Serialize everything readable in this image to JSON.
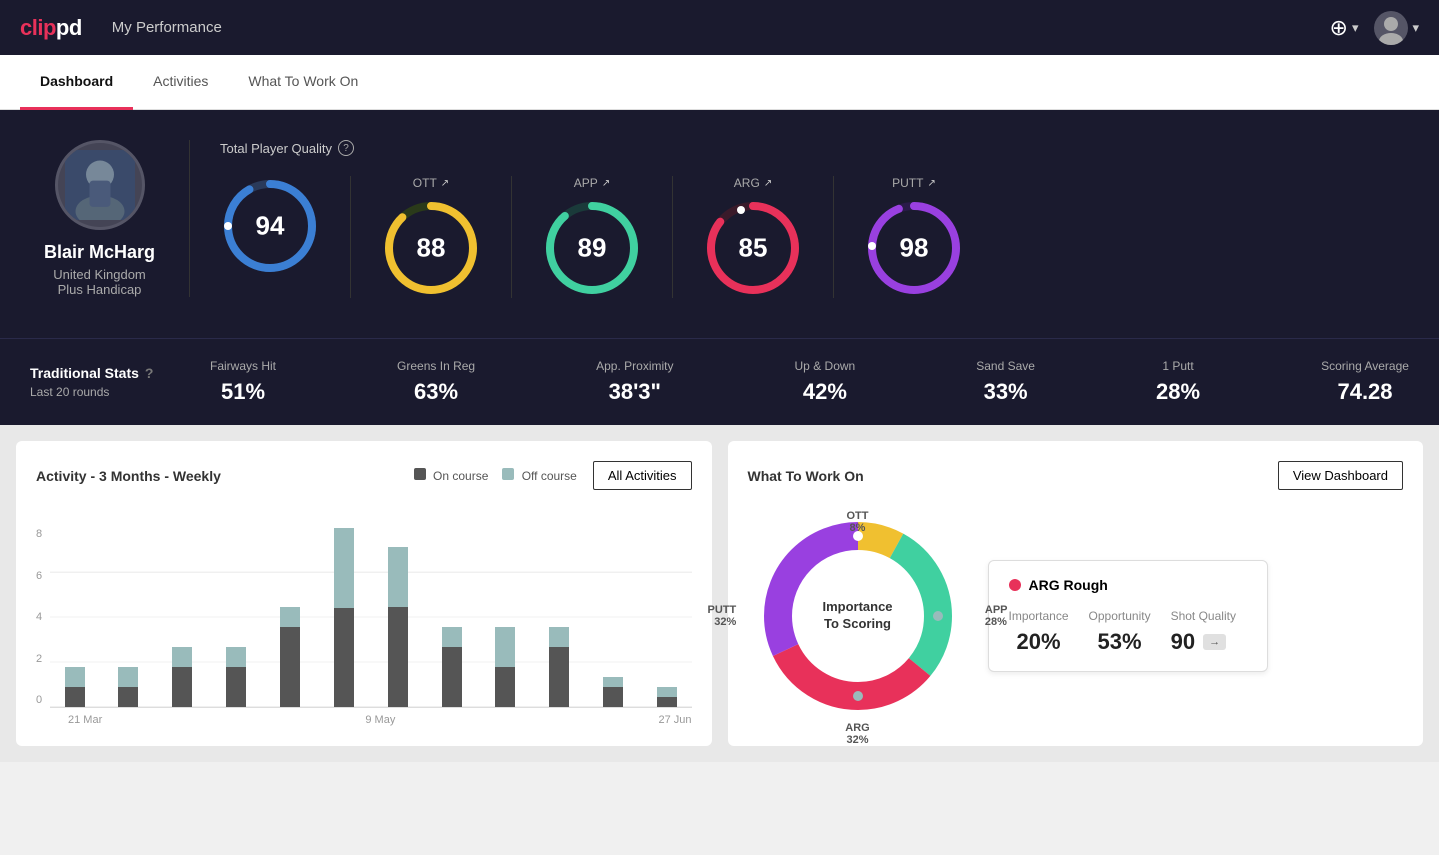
{
  "header": {
    "logo": "clippd",
    "title": "My Performance",
    "add_icon": "⊕",
    "chevron": "▾"
  },
  "tabs": [
    {
      "id": "dashboard",
      "label": "Dashboard",
      "active": true
    },
    {
      "id": "activities",
      "label": "Activities",
      "active": false
    },
    {
      "id": "what-to-work-on",
      "label": "What To Work On",
      "active": false
    }
  ],
  "player": {
    "name": "Blair McHarg",
    "country": "United Kingdom",
    "handicap": "Plus Handicap"
  },
  "total_player_quality": {
    "label": "Total Player Quality",
    "value": 94,
    "color": "#3b7fd4",
    "track_color": "#2a3a5a"
  },
  "scores": [
    {
      "id": "ott",
      "label": "OTT",
      "value": 88,
      "color": "#f0c030",
      "track": "#2a3a2a"
    },
    {
      "id": "app",
      "label": "APP",
      "value": 89,
      "color": "#40d0a0",
      "track": "#1a3a3a"
    },
    {
      "id": "arg",
      "label": "ARG",
      "value": 85,
      "color": "#e8315a",
      "track": "#3a1a2a"
    },
    {
      "id": "putt",
      "label": "PUTT",
      "value": 98,
      "color": "#9940e0",
      "track": "#2a1a4a"
    }
  ],
  "traditional_stats": {
    "title": "Traditional Stats",
    "subtitle": "Last 20 rounds",
    "items": [
      {
        "id": "fairways-hit",
        "label": "Fairways Hit",
        "value": "51%"
      },
      {
        "id": "greens-in-reg",
        "label": "Greens In Reg",
        "value": "63%"
      },
      {
        "id": "app-proximity",
        "label": "App. Proximity",
        "value": "38'3\""
      },
      {
        "id": "up-down",
        "label": "Up & Down",
        "value": "42%"
      },
      {
        "id": "sand-save",
        "label": "Sand Save",
        "value": "33%"
      },
      {
        "id": "1-putt",
        "label": "1 Putt",
        "value": "28%"
      },
      {
        "id": "scoring-average",
        "label": "Scoring Average",
        "value": "74.28"
      }
    ]
  },
  "activity_chart": {
    "title": "Activity - 3 Months - Weekly",
    "legend": [
      {
        "label": "On course",
        "color": "#555"
      },
      {
        "label": "Off course",
        "color": "#9bb"
      }
    ],
    "all_activities_btn": "All Activities",
    "y_labels": [
      "8",
      "6",
      "4",
      "2",
      "0"
    ],
    "x_labels": [
      "21 Mar",
      "9 May",
      "27 Jun"
    ],
    "bars": [
      {
        "on": 1,
        "off": 1
      },
      {
        "on": 1,
        "off": 1
      },
      {
        "on": 2,
        "off": 1
      },
      {
        "on": 2,
        "off": 1
      },
      {
        "on": 4,
        "off": 1
      },
      {
        "on": 5,
        "off": 4
      },
      {
        "on": 5,
        "off": 3
      },
      {
        "on": 3,
        "off": 1
      },
      {
        "on": 2,
        "off": 2
      },
      {
        "on": 3,
        "off": 1
      },
      {
        "on": 1,
        "off": 0.5
      },
      {
        "on": 0.5,
        "off": 0.5
      }
    ]
  },
  "what_to_work_on": {
    "title": "What To Work On",
    "view_dashboard_btn": "View Dashboard",
    "donut_center": "Importance\nTo Scoring",
    "segments": [
      {
        "id": "ott",
        "label": "OTT",
        "percent": "8%",
        "color": "#f0c030",
        "pct_num": 8
      },
      {
        "id": "app",
        "label": "APP",
        "percent": "28%",
        "color": "#40d0a0",
        "pct_num": 28
      },
      {
        "id": "arg",
        "label": "ARG",
        "percent": "32%",
        "color": "#e8315a",
        "pct_num": 32
      },
      {
        "id": "putt",
        "label": "PUTT",
        "percent": "32%",
        "color": "#9940e0",
        "pct_num": 32
      }
    ],
    "info_card": {
      "title": "ARG Rough",
      "dot_color": "#e8315a",
      "metrics": [
        {
          "label": "Importance",
          "value": "20%"
        },
        {
          "label": "Opportunity",
          "value": "53%"
        },
        {
          "label": "Shot Quality",
          "value": "90",
          "badge": "→"
        }
      ]
    }
  }
}
